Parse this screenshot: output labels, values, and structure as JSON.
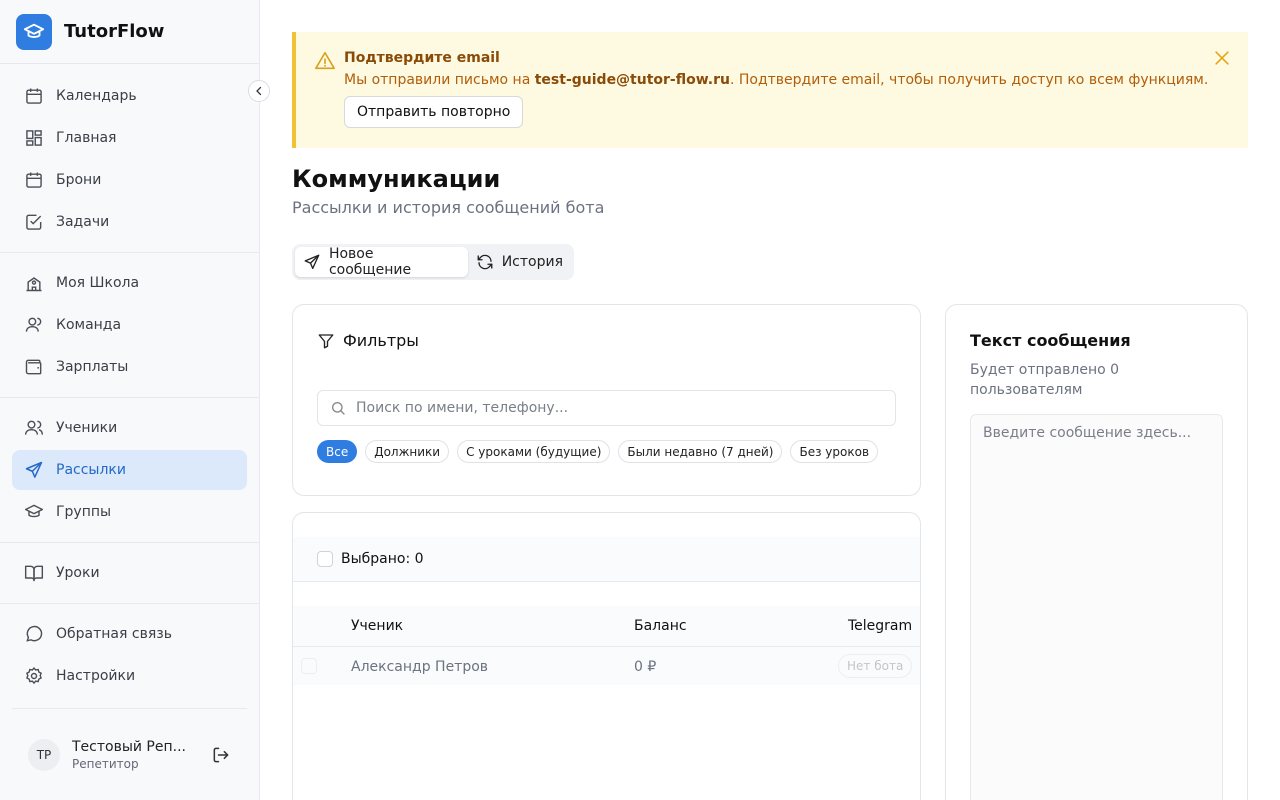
{
  "brand": {
    "name": "TutorFlow"
  },
  "sidebar": {
    "groups": [
      {
        "items": [
          {
            "label": "Календарь",
            "icon": "calendar-icon"
          },
          {
            "label": "Главная",
            "icon": "dashboard-icon"
          },
          {
            "label": "Брони",
            "icon": "calendar-icon"
          },
          {
            "label": "Задачи",
            "icon": "checkbox-icon"
          }
        ]
      },
      {
        "items": [
          {
            "label": "Моя Школа",
            "icon": "school-icon"
          },
          {
            "label": "Команда",
            "icon": "user-icon"
          },
          {
            "label": "Зарплаты",
            "icon": "wallet-icon"
          }
        ]
      },
      {
        "items": [
          {
            "label": "Ученики",
            "icon": "users-icon"
          },
          {
            "label": "Рассылки",
            "icon": "send-icon",
            "active": true
          },
          {
            "label": "Группы",
            "icon": "graduation-cap-icon"
          }
        ]
      },
      {
        "items": [
          {
            "label": "Уроки",
            "icon": "book-icon"
          }
        ]
      },
      {
        "items": [
          {
            "label": "Обратная связь",
            "icon": "message-icon"
          },
          {
            "label": "Настройки",
            "icon": "gear-icon"
          }
        ]
      }
    ]
  },
  "user": {
    "initials": "TP",
    "name": "Тестовый Репетитор",
    "name_display": "Тестовый Реп...",
    "role": "Репетитор"
  },
  "banner": {
    "title": "Подтвердите email",
    "text_before": "Мы отправили письмо на ",
    "email": "test-guide@tutor-flow.ru",
    "text_after": ". Подтвердите email, чтобы получить доступ ко всем функциям.",
    "resend_label": "Отправить повторно"
  },
  "page": {
    "title": "Коммуникации",
    "subtitle": "Рассылки и история сообщений бота"
  },
  "tabs": [
    {
      "label": "Новое сообщение",
      "active": true
    },
    {
      "label": "История",
      "active": false
    }
  ],
  "filters": {
    "title": "Фильтры",
    "search_placeholder": "Поиск по имени, телефону...",
    "chips": [
      "Все",
      "Должники",
      "С уроками (будущие)",
      "Были недавно (7 дней)",
      "Без уроков"
    ],
    "active_chip": "Все"
  },
  "list": {
    "selected_label": "Выбрано: 0",
    "columns": [
      "Ученик",
      "Баланс",
      "Telegram"
    ],
    "rows": [
      {
        "name": "Александр Петров",
        "balance": "0 ₽",
        "telegram": "Нет бота"
      }
    ]
  },
  "message": {
    "title": "Текст сообщения",
    "subtitle": "Будет отправлено 0 пользователям",
    "placeholder": "Введите сообщение здесь..."
  },
  "colors": {
    "accent": "#2f7de1",
    "active_bg": "#dbe9fa",
    "banner_bg": "#fef9e1",
    "banner_border": "#f1c232"
  }
}
